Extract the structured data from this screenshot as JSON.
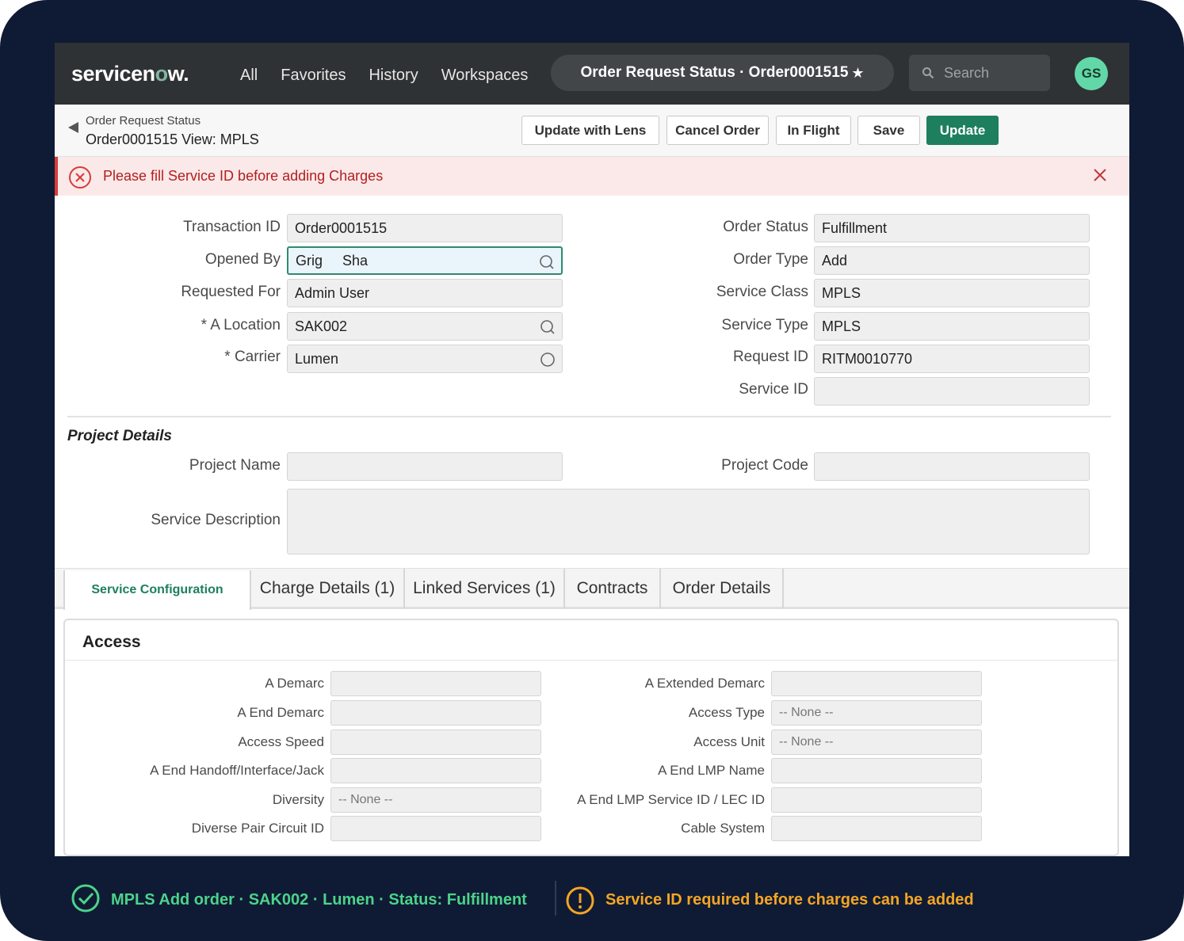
{
  "brand": {
    "text_a": "servicen",
    "text_o": "o",
    "text_b": "w."
  },
  "nav": {
    "links": [
      "All",
      "Favorites",
      "History",
      "Workspaces"
    ],
    "title": "Order Request Status · Order0001515",
    "star": "★",
    "search_placeholder": "Search",
    "avatar_initials": "GS"
  },
  "header": {
    "breadcrumb": "Order Request Status",
    "record": "Order0001515 View: MPLS",
    "buttons": {
      "update_with_lens": "Update with Lens",
      "cancel_order": "Cancel Order",
      "in_flight": "In Flight",
      "save": "Save",
      "update": "Update"
    }
  },
  "alert": {
    "message": "Please fill Service ID before adding Charges"
  },
  "form": {
    "left": [
      {
        "label": "Transaction ID",
        "value": "Order0001515"
      },
      {
        "label": "Opened By",
        "value": "Grig     Sha"
      },
      {
        "label": "Requested For",
        "value": "Admin User"
      },
      {
        "label": "* A Location",
        "value": "SAK002"
      },
      {
        "label": "* Carrier",
        "value": "Lumen"
      }
    ],
    "right": [
      {
        "label": "Order Status",
        "value": "Fulfillment"
      },
      {
        "label": "Order Type",
        "value": "Add"
      },
      {
        "label": "Service Class",
        "value": "MPLS"
      },
      {
        "label": "Service Type",
        "value": "MPLS"
      },
      {
        "label": "Request ID",
        "value": "RITM0010770"
      },
      {
        "label": "Service ID",
        "value": ""
      }
    ]
  },
  "project": {
    "section_title": "Project Details",
    "project_name_label": "Project Name",
    "project_name_value": "",
    "project_code_label": "Project Code",
    "project_code_value": "",
    "service_description_label": "Service Description",
    "service_description_value": ""
  },
  "tabs": [
    "Service Configuration",
    "Charge Details (1)",
    "Linked Services (1)",
    "Contracts",
    "Order Details"
  ],
  "access": {
    "title": "Access",
    "left": [
      {
        "label": "A Demarc",
        "value": ""
      },
      {
        "label": "A End Demarc",
        "value": ""
      },
      {
        "label": "Access Speed",
        "value": ""
      },
      {
        "label": "A End Handoff/Interface/Jack",
        "value": ""
      },
      {
        "label": "Diversity",
        "value": "-- None --"
      },
      {
        "label": "Diverse Pair Circuit ID",
        "value": ""
      }
    ],
    "right": [
      {
        "label": "A Extended Demarc",
        "value": ""
      },
      {
        "label": "Access Type",
        "value": "-- None --"
      },
      {
        "label": "Access Unit",
        "value": "-- None --"
      },
      {
        "label": "A End LMP Name",
        "value": ""
      },
      {
        "label": "A End LMP Service ID / LEC ID",
        "value": ""
      },
      {
        "label": "Cable System",
        "value": ""
      }
    ]
  },
  "footer": {
    "status": "MPLS Add order · SAK002 · Lumen · Status: Fulfillment",
    "warning": "Service ID required before charges can be added"
  },
  "colors": {
    "accent": "#1d7f5e",
    "error": "#d63c3c",
    "success": "#4cd38a",
    "warning": "#f5a524",
    "nav_bg": "#2f3234",
    "frame_bg": "#0f1b34"
  }
}
